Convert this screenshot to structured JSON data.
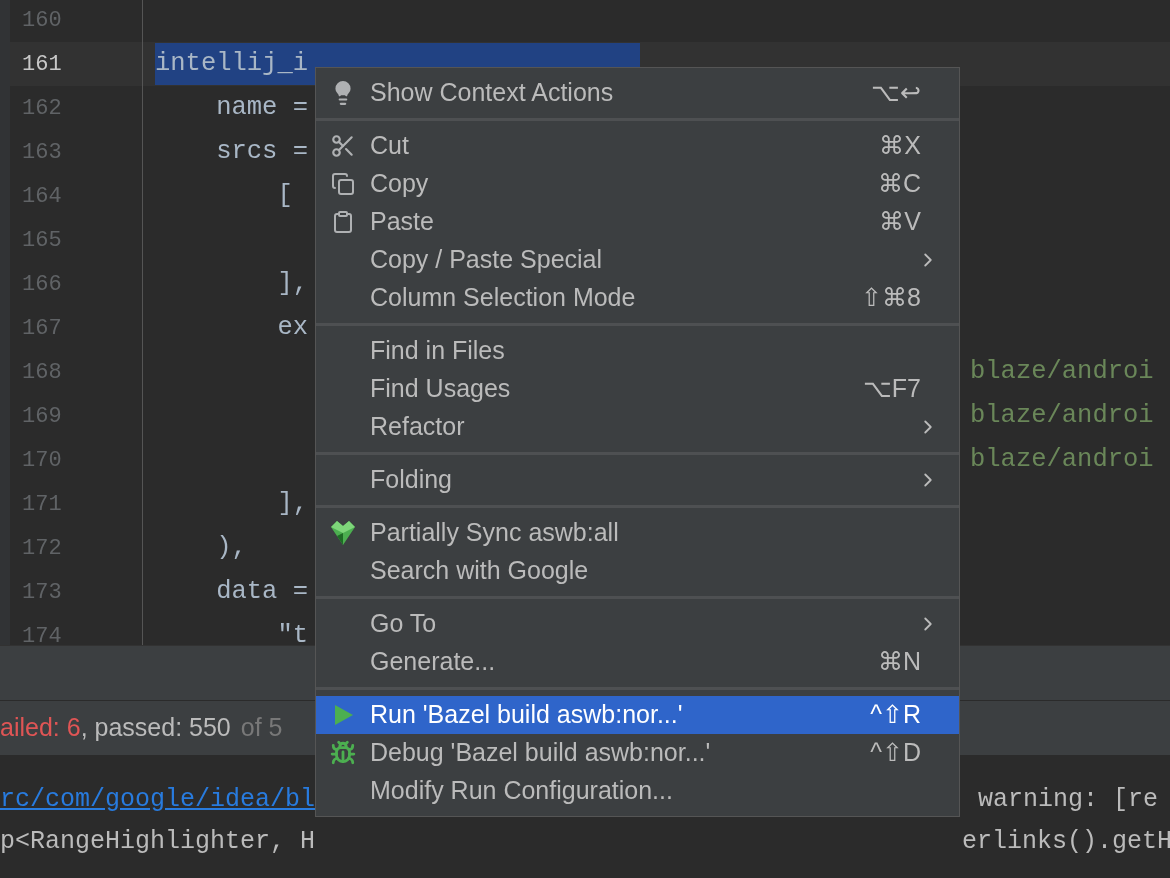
{
  "editor": {
    "lines": [
      {
        "number": "160",
        "current": false
      },
      {
        "number": "161",
        "text": "intellij_i",
        "current": true
      },
      {
        "number": "162",
        "text": "    name =",
        "current": false
      },
      {
        "number": "163",
        "text": "    srcs =",
        "current": false
      },
      {
        "number": "164",
        "text": "        [",
        "current": false
      },
      {
        "number": "165",
        "current": false
      },
      {
        "number": "166",
        "text": "        ],",
        "current": false
      },
      {
        "number": "167",
        "text": "        ex",
        "current": false
      },
      {
        "number": "168",
        "right_text": "blaze/androi",
        "current": false
      },
      {
        "number": "169",
        "right_text": "blaze/androi",
        "current": false
      },
      {
        "number": "170",
        "right_text": "blaze/androi",
        "current": false
      },
      {
        "number": "171",
        "text": "        ],",
        "current": false
      },
      {
        "number": "172",
        "text": "    ),",
        "current": false
      },
      {
        "number": "173",
        "text": "    data =",
        "current": false
      },
      {
        "number": "174",
        "text": "        \"t",
        "current": false
      }
    ]
  },
  "test_status": [
    {
      "text": "ailed: 6",
      "kind": "failed"
    },
    {
      "text": ", passed: 550",
      "kind": "passed"
    },
    {
      "text": "of 5",
      "kind": "total"
    }
  ],
  "console": [
    {
      "text": "rc/com/google/idea/bl",
      "kind": "link",
      "right_text": "warning: [re"
    },
    {
      "text": "p<RangeHighlighter, H",
      "kind": "plain",
      "right_text": "erlinks().getH"
    }
  ],
  "context_menu": {
    "groups": [
      {
        "items": [
          {
            "label": "Show Context Actions",
            "shortcut": "⌥↩",
            "submenu": false,
            "selected": false
          }
        ]
      },
      {
        "items": [
          {
            "label": "Cut",
            "shortcut": "⌘X",
            "submenu": false,
            "selected": false
          },
          {
            "label": "Copy",
            "shortcut": "⌘C",
            "submenu": false,
            "selected": false
          },
          {
            "label": "Paste",
            "shortcut": "⌘V",
            "submenu": false,
            "selected": false
          },
          {
            "label": "Copy / Paste Special",
            "submenu": true,
            "selected": false
          },
          {
            "label": "Column Selection Mode",
            "shortcut": "⇧⌘8",
            "submenu": false,
            "selected": false
          }
        ]
      },
      {
        "items": [
          {
            "label": "Find in Files",
            "submenu": false,
            "selected": false
          },
          {
            "label": "Find Usages",
            "shortcut": "⌥F7",
            "submenu": false,
            "selected": false
          },
          {
            "label": "Refactor",
            "submenu": true,
            "selected": false
          }
        ]
      },
      {
        "items": [
          {
            "label": "Folding",
            "submenu": true,
            "selected": false
          }
        ]
      },
      {
        "items": [
          {
            "label": "Partially Sync aswb:all",
            "submenu": false,
            "selected": false
          },
          {
            "label": "Search with Google",
            "submenu": false,
            "selected": false
          }
        ]
      },
      {
        "items": [
          {
            "label": "Go To",
            "submenu": true,
            "selected": false
          },
          {
            "label": "Generate...",
            "shortcut": "⌘N",
            "submenu": false,
            "selected": false
          }
        ]
      },
      {
        "items": [
          {
            "label": "Run 'Bazel build aswb:nor...'",
            "shortcut": "^⇧R",
            "submenu": false,
            "selected": true
          },
          {
            "label": "Debug 'Bazel build aswb:nor...'",
            "shortcut": "^⇧D",
            "submenu": false,
            "selected": false
          },
          {
            "label": "Modify Run Configuration...",
            "submenu": false,
            "selected": false
          }
        ]
      }
    ]
  }
}
